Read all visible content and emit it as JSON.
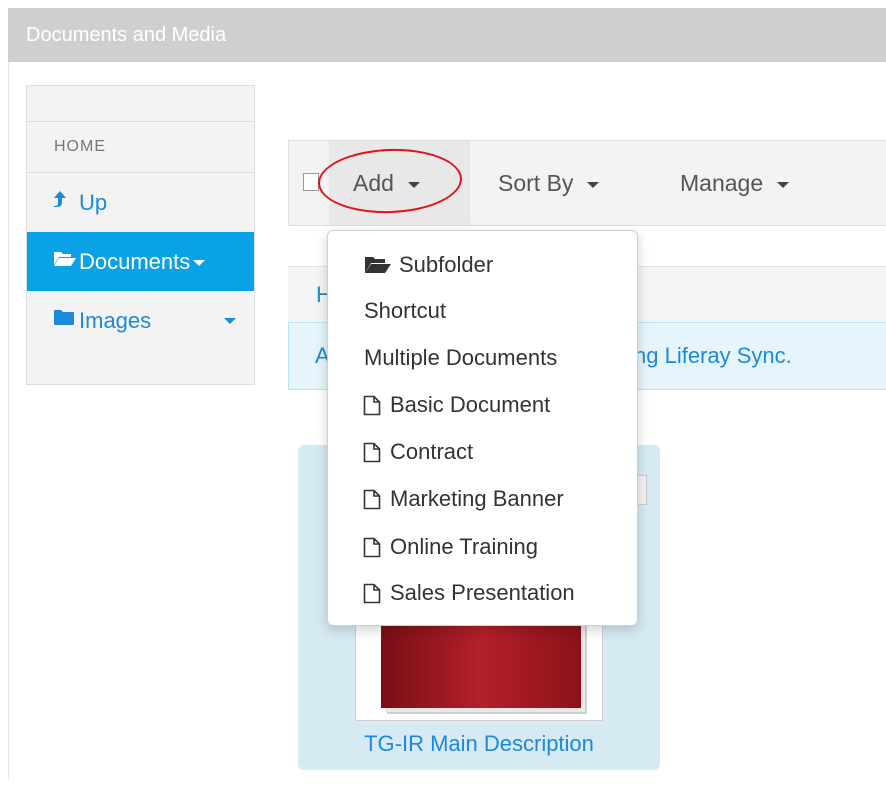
{
  "portlet": {
    "title": "Documents and Media"
  },
  "sidebar": {
    "home_label": "HOME",
    "items": [
      {
        "label": "Up",
        "icon": "up-arrow-icon"
      },
      {
        "label": "Documents",
        "icon": "folder-open-icon",
        "active": true
      },
      {
        "label": "Images",
        "icon": "folder-icon"
      }
    ]
  },
  "toolbar": {
    "add_label": "Add",
    "sort_label": "Sort By",
    "manage_label": "Manage"
  },
  "breadcrumb": {
    "text": "H"
  },
  "info": {
    "prefix": "A",
    "suffix": "ng Liferay Sync."
  },
  "card": {
    "title": "TG-IR Main Description"
  },
  "add_menu": {
    "items": [
      {
        "label": "Subfolder",
        "icon": "folder-open-icon"
      },
      {
        "label": "Shortcut",
        "icon": ""
      },
      {
        "label": "Multiple Documents",
        "icon": ""
      },
      {
        "label": "Basic Document",
        "icon": "file-icon"
      },
      {
        "label": "Contract",
        "icon": "file-icon"
      },
      {
        "label": "Marketing Banner",
        "icon": "file-icon"
      },
      {
        "label": "Online Training",
        "icon": "file-icon"
      },
      {
        "label": "Sales Presentation",
        "icon": "file-icon"
      }
    ]
  },
  "colors": {
    "accent": "#0aa2e6",
    "link": "#1c8ad6",
    "annotation": "#e0141a"
  }
}
